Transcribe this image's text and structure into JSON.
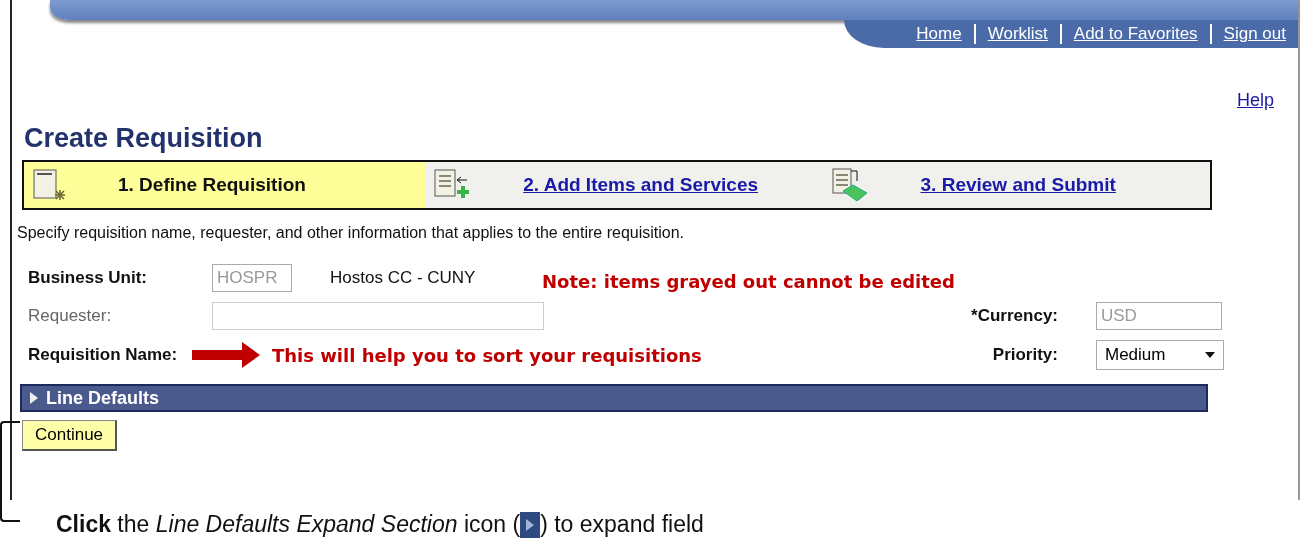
{
  "nav_links": [
    "Home",
    "Worklist",
    "Add to Favorites",
    "Sign out"
  ],
  "help_link": "Help",
  "page_title": "Create Requisition",
  "steps": [
    {
      "label": "1. Define Requisition",
      "selected": true,
      "kind": "define"
    },
    {
      "label": "2. Add Items and Services",
      "selected": false,
      "kind": "add"
    },
    {
      "label": "3. Review and Submit",
      "selected": false,
      "kind": "review"
    }
  ],
  "description": "Specify requisition name, requester, and other information that applies to the entire requisition.",
  "business_unit": {
    "label": "Business Unit:",
    "value": "HOSPR",
    "disabled": true,
    "unit_name": "Hostos CC - CUNY"
  },
  "requester": {
    "label": "Requester:",
    "disabled": true
  },
  "currency": {
    "label": "*Currency:",
    "value": "USD",
    "disabled": true
  },
  "requisition_name": {
    "label": "Requisition Name:"
  },
  "priority": {
    "label": "Priority:",
    "value": "Medium"
  },
  "note": "Note: items grayed out cannot be edited",
  "arrow_note": "This will help you to sort your requisitions",
  "section": {
    "title": "Line Defaults",
    "expanded": false
  },
  "continue_button": "Continue",
  "instruction_before": "**Click** the *Line Defaults Expand Section* icon (",
  "instruction_after": ") to expand field"
}
